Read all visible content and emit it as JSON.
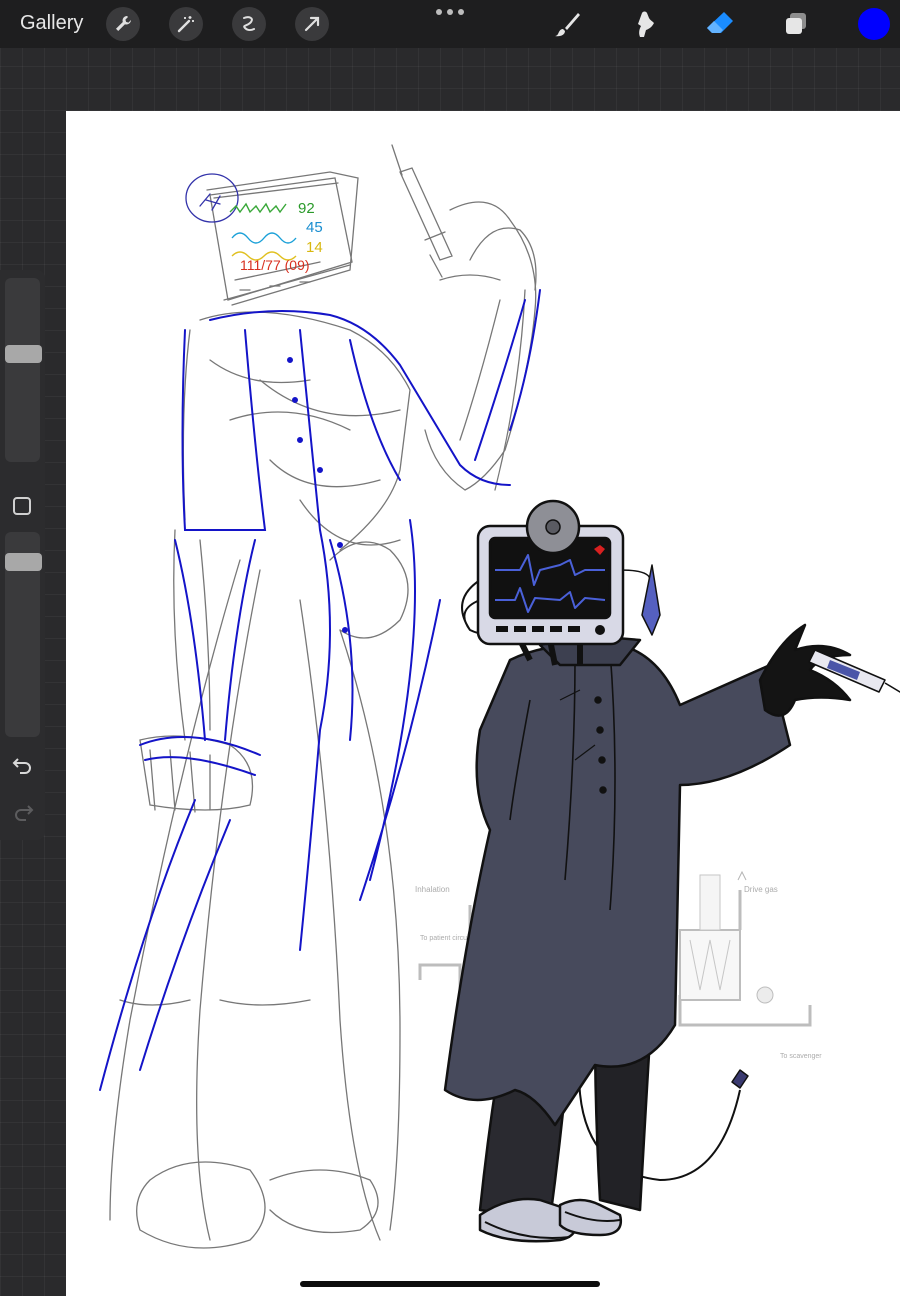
{
  "topbar": {
    "gallery_label": "Gallery",
    "left_tools": [
      "wrench-icon",
      "magic-wand-icon",
      "selection-icon",
      "transform-icon"
    ],
    "right_tools": [
      "brush-icon",
      "smudge-icon",
      "eraser-icon",
      "layers-icon"
    ],
    "active_tool": "eraser-icon",
    "active_color": "#0000ff",
    "accent_color": "#1a8cff"
  },
  "sidebar": {
    "controls": [
      "brush-size-slider",
      "modify-button",
      "opacity-slider",
      "undo-icon",
      "redo-icon"
    ]
  },
  "artwork": {
    "sketch_monitor": {
      "values": [
        "92",
        "45",
        "14"
      ],
      "bp_reading": "111/77 (09)"
    },
    "diagram": {
      "inhalation": "Inhalation",
      "to_patient_circuit": "To patient circuit",
      "drive_gas": "Drive gas",
      "to_scavenger": "To scavenger"
    }
  }
}
